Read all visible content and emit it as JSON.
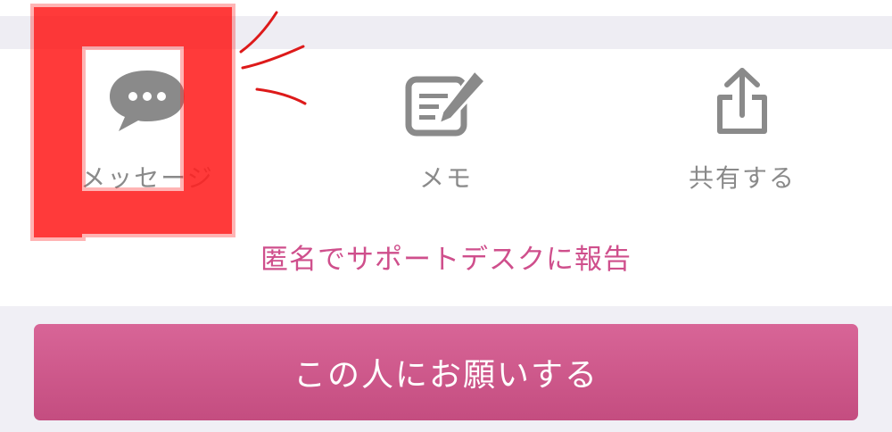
{
  "actions": {
    "message": {
      "label": "メッセージ",
      "icon": "message-bubble-icon"
    },
    "memo": {
      "label": "メモ",
      "icon": "memo-pencil-icon"
    },
    "share": {
      "label": "共有する",
      "icon": "share-icon"
    }
  },
  "report_link": {
    "label": "匿名でサポートデスクに報告"
  },
  "request_button": {
    "label": "この人にお願いする"
  },
  "colors": {
    "accent": "#cf4f8c",
    "button": "#d15a8d",
    "icon_gray": "#8a8a8a",
    "annotation_red": "#ff0000"
  }
}
